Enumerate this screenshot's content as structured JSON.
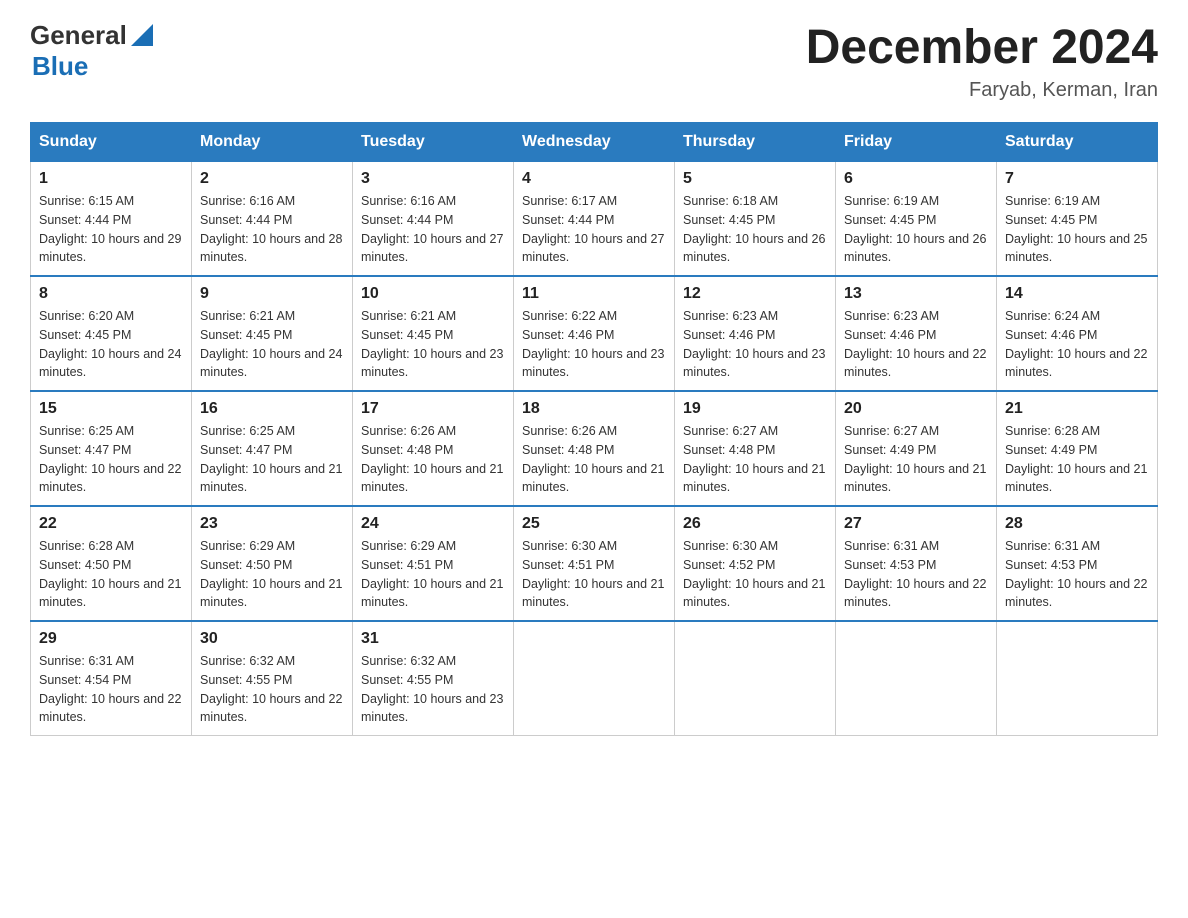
{
  "header": {
    "logo_general": "General",
    "logo_blue": "Blue",
    "month_year": "December 2024",
    "location": "Faryab, Kerman, Iran"
  },
  "weekdays": [
    "Sunday",
    "Monday",
    "Tuesday",
    "Wednesday",
    "Thursday",
    "Friday",
    "Saturday"
  ],
  "weeks": [
    [
      {
        "day": "1",
        "sunrise": "6:15 AM",
        "sunset": "4:44 PM",
        "daylight": "10 hours and 29 minutes."
      },
      {
        "day": "2",
        "sunrise": "6:16 AM",
        "sunset": "4:44 PM",
        "daylight": "10 hours and 28 minutes."
      },
      {
        "day": "3",
        "sunrise": "6:16 AM",
        "sunset": "4:44 PM",
        "daylight": "10 hours and 27 minutes."
      },
      {
        "day": "4",
        "sunrise": "6:17 AM",
        "sunset": "4:44 PM",
        "daylight": "10 hours and 27 minutes."
      },
      {
        "day": "5",
        "sunrise": "6:18 AM",
        "sunset": "4:45 PM",
        "daylight": "10 hours and 26 minutes."
      },
      {
        "day": "6",
        "sunrise": "6:19 AM",
        "sunset": "4:45 PM",
        "daylight": "10 hours and 26 minutes."
      },
      {
        "day": "7",
        "sunrise": "6:19 AM",
        "sunset": "4:45 PM",
        "daylight": "10 hours and 25 minutes."
      }
    ],
    [
      {
        "day": "8",
        "sunrise": "6:20 AM",
        "sunset": "4:45 PM",
        "daylight": "10 hours and 24 minutes."
      },
      {
        "day": "9",
        "sunrise": "6:21 AM",
        "sunset": "4:45 PM",
        "daylight": "10 hours and 24 minutes."
      },
      {
        "day": "10",
        "sunrise": "6:21 AM",
        "sunset": "4:45 PM",
        "daylight": "10 hours and 23 minutes."
      },
      {
        "day": "11",
        "sunrise": "6:22 AM",
        "sunset": "4:46 PM",
        "daylight": "10 hours and 23 minutes."
      },
      {
        "day": "12",
        "sunrise": "6:23 AM",
        "sunset": "4:46 PM",
        "daylight": "10 hours and 23 minutes."
      },
      {
        "day": "13",
        "sunrise": "6:23 AM",
        "sunset": "4:46 PM",
        "daylight": "10 hours and 22 minutes."
      },
      {
        "day": "14",
        "sunrise": "6:24 AM",
        "sunset": "4:46 PM",
        "daylight": "10 hours and 22 minutes."
      }
    ],
    [
      {
        "day": "15",
        "sunrise": "6:25 AM",
        "sunset": "4:47 PM",
        "daylight": "10 hours and 22 minutes."
      },
      {
        "day": "16",
        "sunrise": "6:25 AM",
        "sunset": "4:47 PM",
        "daylight": "10 hours and 21 minutes."
      },
      {
        "day": "17",
        "sunrise": "6:26 AM",
        "sunset": "4:48 PM",
        "daylight": "10 hours and 21 minutes."
      },
      {
        "day": "18",
        "sunrise": "6:26 AM",
        "sunset": "4:48 PM",
        "daylight": "10 hours and 21 minutes."
      },
      {
        "day": "19",
        "sunrise": "6:27 AM",
        "sunset": "4:48 PM",
        "daylight": "10 hours and 21 minutes."
      },
      {
        "day": "20",
        "sunrise": "6:27 AM",
        "sunset": "4:49 PM",
        "daylight": "10 hours and 21 minutes."
      },
      {
        "day": "21",
        "sunrise": "6:28 AM",
        "sunset": "4:49 PM",
        "daylight": "10 hours and 21 minutes."
      }
    ],
    [
      {
        "day": "22",
        "sunrise": "6:28 AM",
        "sunset": "4:50 PM",
        "daylight": "10 hours and 21 minutes."
      },
      {
        "day": "23",
        "sunrise": "6:29 AM",
        "sunset": "4:50 PM",
        "daylight": "10 hours and 21 minutes."
      },
      {
        "day": "24",
        "sunrise": "6:29 AM",
        "sunset": "4:51 PM",
        "daylight": "10 hours and 21 minutes."
      },
      {
        "day": "25",
        "sunrise": "6:30 AM",
        "sunset": "4:51 PM",
        "daylight": "10 hours and 21 minutes."
      },
      {
        "day": "26",
        "sunrise": "6:30 AM",
        "sunset": "4:52 PM",
        "daylight": "10 hours and 21 minutes."
      },
      {
        "day": "27",
        "sunrise": "6:31 AM",
        "sunset": "4:53 PM",
        "daylight": "10 hours and 22 minutes."
      },
      {
        "day": "28",
        "sunrise": "6:31 AM",
        "sunset": "4:53 PM",
        "daylight": "10 hours and 22 minutes."
      }
    ],
    [
      {
        "day": "29",
        "sunrise": "6:31 AM",
        "sunset": "4:54 PM",
        "daylight": "10 hours and 22 minutes."
      },
      {
        "day": "30",
        "sunrise": "6:32 AM",
        "sunset": "4:55 PM",
        "daylight": "10 hours and 22 minutes."
      },
      {
        "day": "31",
        "sunrise": "6:32 AM",
        "sunset": "4:55 PM",
        "daylight": "10 hours and 23 minutes."
      },
      null,
      null,
      null,
      null
    ]
  ]
}
